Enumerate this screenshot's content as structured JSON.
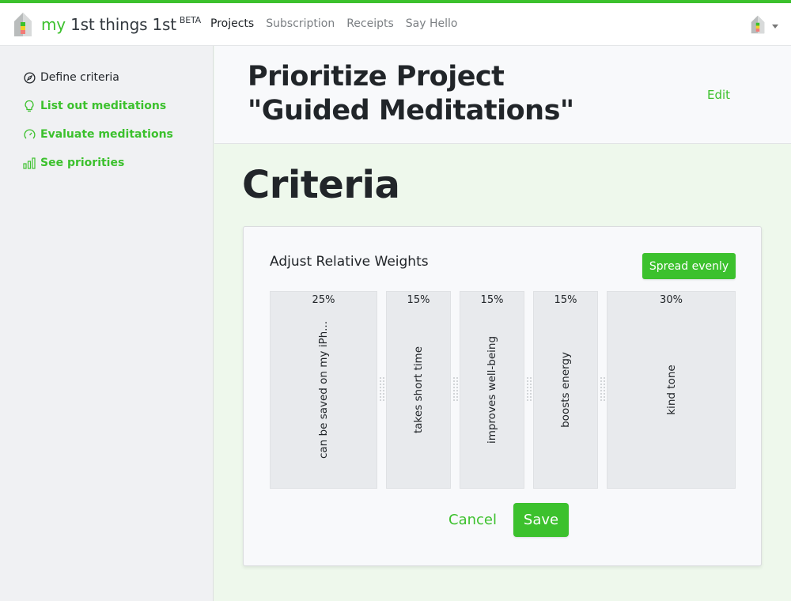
{
  "navbar": {
    "brand_prefix": "my",
    "brand_name": " 1st things 1st",
    "brand_badge": "BETA",
    "links": [
      {
        "label": "Projects",
        "active": true
      },
      {
        "label": "Subscription",
        "active": false
      },
      {
        "label": "Receipts",
        "active": false
      },
      {
        "label": "Say Hello",
        "active": false
      }
    ],
    "user_icon": "house-logo-icon"
  },
  "sidebar": {
    "items": [
      {
        "label": "Define criteria",
        "icon": "compass-icon",
        "current": true
      },
      {
        "label": "List out meditations",
        "icon": "lightbulb-icon",
        "current": false
      },
      {
        "label": "Evaluate meditations",
        "icon": "gauge-icon",
        "current": false
      },
      {
        "label": "See priorities",
        "icon": "bar-chart-icon",
        "current": false
      }
    ]
  },
  "header": {
    "title": "Prioritize Project\n\"Guided Meditations\"",
    "edit_label": "Edit"
  },
  "main": {
    "heading": "Criteria",
    "card": {
      "title": "Adjust Relative Weights",
      "spread_button": "Spread evenly",
      "criteria": [
        {
          "label": "can be saved on my iPh...",
          "weight": "25%",
          "weight_value": 25
        },
        {
          "label": "takes short time",
          "weight": "15%",
          "weight_value": 15
        },
        {
          "label": "improves well-being",
          "weight": "15%",
          "weight_value": 15
        },
        {
          "label": "boosts energy",
          "weight": "15%",
          "weight_value": 15
        },
        {
          "label": "kind tone",
          "weight": "30%",
          "weight_value": 30
        }
      ],
      "cancel_label": "Cancel",
      "save_label": "Save"
    }
  },
  "colors": {
    "accent": "#3cc12d",
    "page_background": "#eef8ec",
    "sidebar_background": "#f0f1f3",
    "criterion_background": "#e8eaed"
  }
}
